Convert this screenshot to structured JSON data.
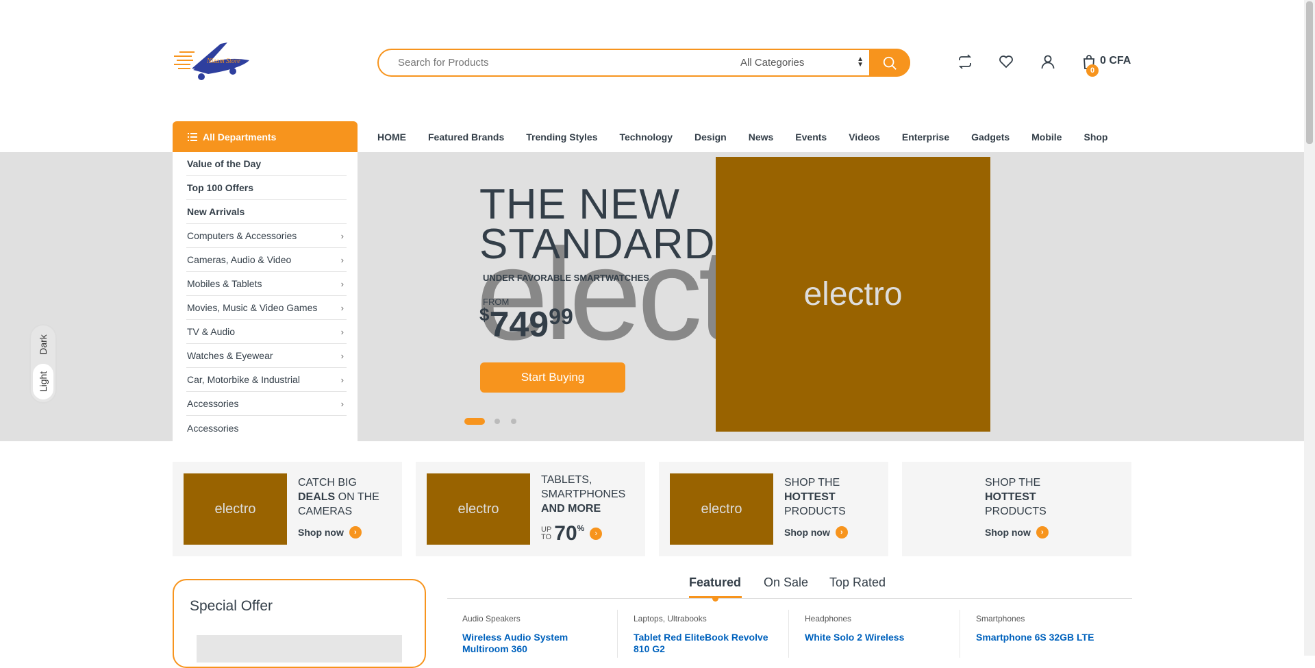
{
  "header": {
    "logo_alt": "Nizam Store",
    "search": {
      "placeholder": "Search for Products",
      "category": "All Categories"
    },
    "cart": {
      "count": "0",
      "total": "0 CFA"
    }
  },
  "departments": {
    "label": "All Departments",
    "items": [
      {
        "label": "Value of the Day",
        "bold": true,
        "submenu": false
      },
      {
        "label": "Top 100 Offers",
        "bold": true,
        "submenu": false
      },
      {
        "label": "New Arrivals",
        "bold": true,
        "submenu": false
      },
      {
        "label": "Computers & Accessories",
        "bold": false,
        "submenu": true
      },
      {
        "label": "Cameras, Audio & Video",
        "bold": false,
        "submenu": true
      },
      {
        "label": "Mobiles & Tablets",
        "bold": false,
        "submenu": true
      },
      {
        "label": "Movies, Music & Video Games",
        "bold": false,
        "submenu": true
      },
      {
        "label": "TV & Audio",
        "bold": false,
        "submenu": true
      },
      {
        "label": "Watches & Eyewear",
        "bold": false,
        "submenu": true
      },
      {
        "label": "Car, Motorbike & Industrial",
        "bold": false,
        "submenu": true
      },
      {
        "label": "Accessories",
        "bold": false,
        "submenu": true
      },
      {
        "label": "Accessories",
        "bold": false,
        "submenu": false
      }
    ]
  },
  "nav": [
    "HOME",
    "Featured Brands",
    "Trending Styles",
    "Technology",
    "Design",
    "News",
    "Events",
    "Videos",
    "Enterprise",
    "Gadgets",
    "Mobile",
    "Shop"
  ],
  "hero": {
    "title_line1": "THE NEW",
    "title_line2": "STANDARD",
    "bg_text": "elect",
    "subtitle": "UNDER FAVORABLE SMARTWATCHES",
    "from": "FROM",
    "price_currency": "$",
    "price_int": "749",
    "price_dec": "99",
    "cta": "Start Buying",
    "image_text": "electro",
    "slides": 3,
    "active_slide": 1
  },
  "theme": {
    "dark": "Dark",
    "light": "Light",
    "selected": "Light"
  },
  "promos": [
    {
      "l1": "CATCH BIG",
      "b1": "DEALS",
      "l2": " ON THE",
      "l3": "CAMERAS",
      "shop": "Shop now",
      "img": "electro"
    },
    {
      "l1": "TABLETS,",
      "l2": "SMARTPHONES",
      "b1": "AND MORE",
      "up": "UP",
      "to": "TO",
      "pct": "70",
      "pct_sign": "%",
      "img": "electro"
    },
    {
      "l1": "SHOP THE",
      "b1": "HOTTEST",
      "l2": "PRODUCTS",
      "shop": "Shop now",
      "img": "electro"
    },
    {
      "l1": "SHOP THE",
      "b1": "HOTTEST",
      "l2": "PRODUCTS",
      "shop": "Shop now"
    }
  ],
  "special_offer": {
    "title": "Special Offer"
  },
  "tabs": [
    "Featured",
    "On Sale",
    "Top Rated"
  ],
  "products": [
    {
      "category": "Audio Speakers",
      "name": "Wireless Audio System Multiroom 360"
    },
    {
      "category": "Laptops, Ultrabooks",
      "name": "Tablet Red EliteBook Revolve 810 G2"
    },
    {
      "category": "Headphones",
      "name": "White Solo 2 Wireless"
    },
    {
      "category": "Smartphones",
      "name": "Smartphone 6S 32GB LTE"
    }
  ],
  "colors": {
    "accent": "#f7941d",
    "text": "#333e48",
    "link": "#0062bd",
    "hero_bg": "#e0e0e0",
    "placeholder_img": "#996300"
  }
}
